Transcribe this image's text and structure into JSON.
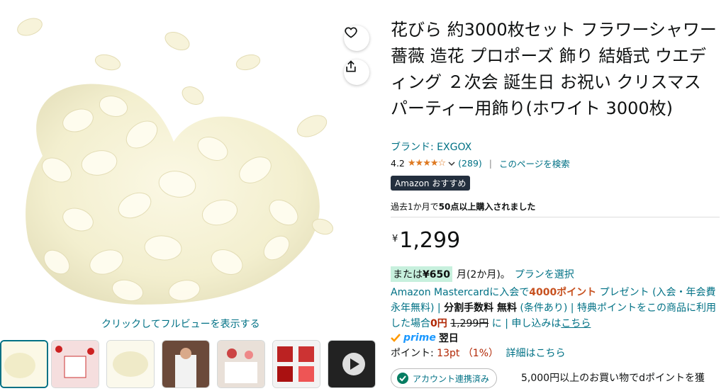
{
  "product": {
    "title": "花びら 約3000枚セット フラワーシャワー 薔薇 造花 プロポーズ 飾り 結婚式 ウエディング ２次会 誕生日 お祝い クリスマス パーティー用飾り(ホワイト 3000枚)",
    "brand": "ブランド: EXGOX",
    "rating": "4.2",
    "rating_value": 4.2,
    "review_count": "(289)",
    "search_page": "このページを検索",
    "badge": "Amazon おすすめ",
    "bought_prefix": "過去1か月で",
    "bought_bold": "50点以上購入されました"
  },
  "image": {
    "fullview_label": "クリックしてフルビューを表示する"
  },
  "price": {
    "currency": "¥",
    "amount": "1,299",
    "installment_prefix": "または",
    "installment_amount": "¥650",
    "installment_suffix": "月(2か月)。",
    "installment_link": "プランを選択"
  },
  "mastercard": {
    "p1": "Amazon Mastercardに入会で",
    "p1_bold": "4000ポイント",
    "p2": " プレゼント (入会・年会費 永年無料) | ",
    "p2_bold": "分割手数料 無料",
    "p3": " (条件あり) | 特典ポイントをこの商品に利用した場合",
    "zero": "0円",
    "strike": "1,299円",
    "p4": " に | 申し込みは",
    "link": "こちら"
  },
  "prime": {
    "logo": "prime",
    "delivery": "翌日"
  },
  "points": {
    "label": "ポイント: ",
    "value": "13pt （1%）",
    "link": "詳細はこちら"
  },
  "account": {
    "linked": "アカウント連携済み",
    "dpoint_text": "5,000円以上のお買い物でdポイントを獲"
  },
  "colors": {
    "link": "#007185",
    "star": "#de7921",
    "price_red": "#b12704",
    "badge_bg": "#232f3e"
  }
}
